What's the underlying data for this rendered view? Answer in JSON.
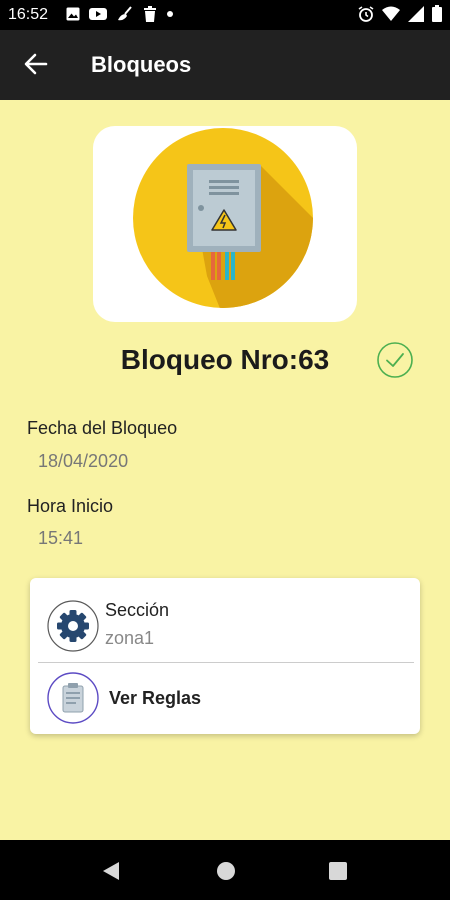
{
  "status_bar": {
    "time": "16:52",
    "left_icons": [
      "image-icon",
      "youtube-icon",
      "broom-icon",
      "trash-icon",
      "dot-icon"
    ],
    "right_icons": [
      "alarm-icon",
      "wifi-icon",
      "signal-icon",
      "battery-icon"
    ]
  },
  "app_bar": {
    "title": "Bloqueos",
    "back_icon": "arrow-left-icon"
  },
  "lock": {
    "illustration": "electrical-panel-icon",
    "title": "Bloqueo Nro:63",
    "status_icon": "check-circle-icon",
    "status_color": "#4caf50"
  },
  "details": {
    "date_label": "Fecha del Bloqueo",
    "date_value": "18/04/2020",
    "time_label": "Hora Inicio",
    "time_value": "15:41"
  },
  "card": {
    "section_label": "Sección",
    "section_value": "zona1",
    "section_icon": "gear-icon",
    "rules_label": "Ver Reglas",
    "rules_icon": "clipboard-icon"
  },
  "nav_bar": {
    "buttons": [
      "back-triangle-icon",
      "home-circle-icon",
      "recents-square-icon"
    ]
  },
  "colors": {
    "background": "#f9f3a4",
    "app_bar": "#212121",
    "accent_yellow": "#f5c518",
    "gear_blue": "#26476f",
    "clipboard_ring": "#5c4bc4"
  }
}
